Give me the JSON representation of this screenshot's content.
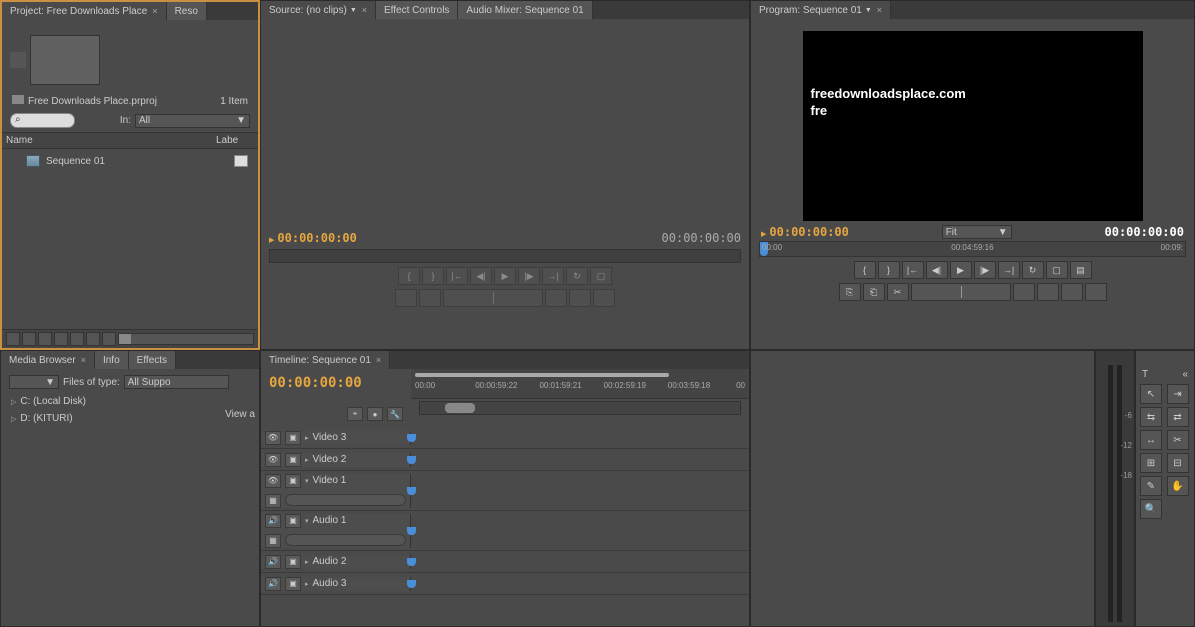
{
  "project": {
    "tab_label": "Project: Free Downloads Place",
    "secondary_tab": "Reso",
    "file_name": "Free Downloads Place.prproj",
    "item_count": "1 Item",
    "in_label": "In:",
    "in_value": "All",
    "col_name": "Name",
    "col_label": "Labe",
    "sequence_name": "Sequence 01"
  },
  "source": {
    "tab_label": "Source: (no clips)",
    "tab_effect": "Effect Controls",
    "tab_audio": "Audio Mixer: Sequence 01",
    "tc_in": "00:00:00:00",
    "tc_out": "00:00:00:00"
  },
  "program": {
    "tab_label": "Program: Sequence 01",
    "watermark1": "freedownloadsplace.com",
    "watermark2": "fre",
    "tc_in": "00:00:00:00",
    "tc_out": "00:00:00:00",
    "fit_label": "Fit",
    "ruler_start": "00:00",
    "ruler_mid": "00:04:59:16",
    "ruler_end": "00:09:"
  },
  "media_browser": {
    "tab_mb": "Media Browser",
    "tab_info": "Info",
    "tab_fx": "Effects",
    "files_of_type": "Files of type:",
    "files_value": "All Suppo",
    "drives": [
      "C: (Local Disk)",
      "D: (KITURI)"
    ],
    "view_label": "View a"
  },
  "timeline": {
    "tab_label": "Timeline: Sequence 01",
    "tc": "00:00:00:00",
    "ruler": [
      "00:00",
      "00:00:59:22",
      "00:01:59:21",
      "00:02:59:19",
      "00:03:59:18",
      "00"
    ],
    "tracks_video": [
      "Video 3",
      "Video 2",
      "Video 1"
    ],
    "tracks_audio": [
      "Audio 1",
      "Audio 2",
      "Audio 3"
    ]
  },
  "tools": {
    "header": "T"
  },
  "meters": {
    "labels": [
      "-6",
      "-12",
      "-18"
    ]
  }
}
